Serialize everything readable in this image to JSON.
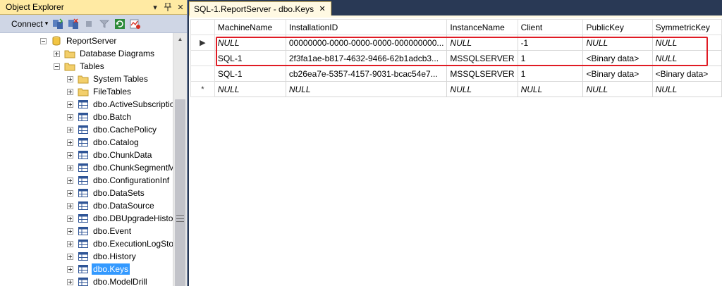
{
  "object_explorer": {
    "title": "Object Explorer",
    "pin_glyph": "▾",
    "pin2_glyph": "ᵖ",
    "close_glyph": "✕",
    "toolbar": {
      "connect_label": "Connect",
      "connect_arrow": "▾"
    },
    "tree": {
      "server": "ReportServer",
      "database_diagrams": "Database Diagrams",
      "tables": "Tables",
      "items": [
        "System Tables",
        "FileTables",
        "dbo.ActiveSubscriptio",
        "dbo.Batch",
        "dbo.CachePolicy",
        "dbo.Catalog",
        "dbo.ChunkData",
        "dbo.ChunkSegmentM",
        "dbo.ConfigurationInf",
        "dbo.DataSets",
        "dbo.DataSource",
        "dbo.DBUpgradeHisto",
        "dbo.Event",
        "dbo.ExecutionLogSto",
        "dbo.History",
        "dbo.Keys",
        "dbo.ModelDrill"
      ],
      "selected": "dbo.Keys"
    }
  },
  "document": {
    "tab_title": "SQL-1.ReportServer - dbo.Keys",
    "tab_close": "✕",
    "grid": {
      "columns": [
        "MachineName",
        "InstallationID",
        "InstanceName",
        "Client",
        "PublicKey",
        "SymmetricKey"
      ],
      "rows": [
        {
          "marker": "▶",
          "cells": [
            "NULL",
            "00000000-0000-0000-0000-000000000...",
            "NULL",
            "-1",
            "NULL",
            "NULL"
          ]
        },
        {
          "marker": "",
          "cells": [
            "SQL-1",
            "2f3fa1ae-b817-4632-9466-62b1adcb3...",
            "MSSQLSERVER",
            "1",
            "<Binary data>",
            "NULL"
          ]
        },
        {
          "marker": "",
          "cells": [
            "SQL-1",
            "cb26ea7e-5357-4157-9031-bcac54e7...",
            "MSSQLSERVER",
            "1",
            "<Binary data>",
            "<Binary data>"
          ]
        },
        {
          "marker": "*",
          "cells": [
            "NULL",
            "NULL",
            "NULL",
            "NULL",
            "NULL",
            "NULL"
          ]
        }
      ]
    }
  },
  "colors": {
    "panel_title_bg": "#ffeaa3",
    "selection": "#3399ff",
    "highlight_box": "#e01b24",
    "chrome": "#293955"
  }
}
